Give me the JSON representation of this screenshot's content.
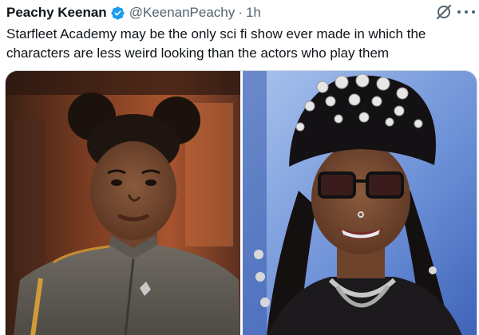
{
  "tweet": {
    "author": {
      "display_name": "Peachy Keenan",
      "handle": "@KeenanPeachy",
      "verified": true
    },
    "separator": "·",
    "timestamp": "1h",
    "text_lines": [
      "Starfleet Academy may be the only sci fi show ever made in which the",
      "characters are less weird looking than the actors who play them"
    ]
  },
  "icons": {
    "verified": "verified-badge-icon",
    "grok": "grok-icon",
    "more": "more-options-icon"
  },
  "colors": {
    "text_primary": "#0f1419",
    "text_secondary": "#536471",
    "verified_blue": "#1d9bf0",
    "border": "#cfd9de"
  },
  "media": {
    "count": 2
  }
}
